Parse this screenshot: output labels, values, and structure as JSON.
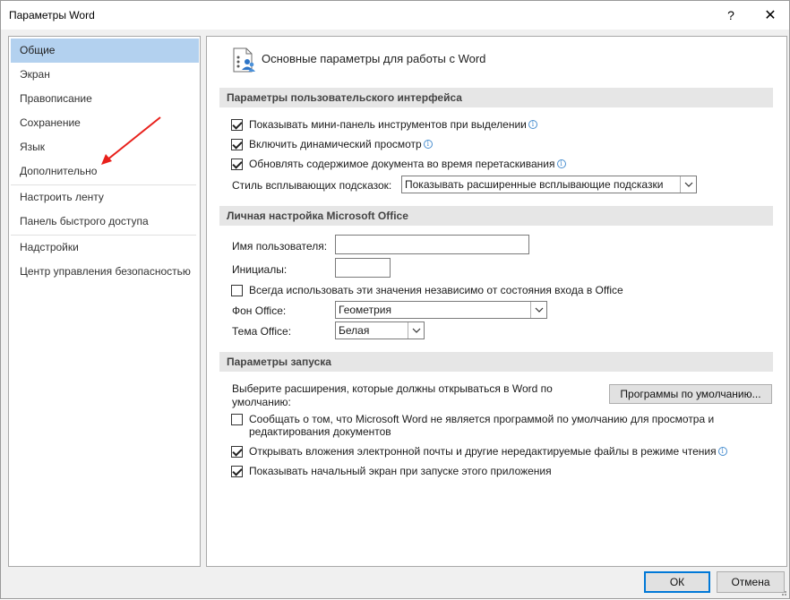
{
  "window": {
    "title": "Параметры Word",
    "help_label": "?",
    "close_label": "✕"
  },
  "nav": {
    "items": [
      {
        "label": "Общие",
        "selected": true
      },
      {
        "label": "Экран"
      },
      {
        "label": "Правописание"
      },
      {
        "label": "Сохранение"
      },
      {
        "label": "Язык"
      },
      {
        "label": "Дополнительно"
      },
      {
        "label": "Настроить ленту"
      },
      {
        "label": "Панель быстрого доступа"
      },
      {
        "label": "Надстройки"
      },
      {
        "label": "Центр управления безопасностью"
      }
    ]
  },
  "annotation": {
    "arrow_color": "#e8201b"
  },
  "content": {
    "header_title": "Основные параметры для работы с Word",
    "ui_section": {
      "title": "Параметры пользовательского интерфейса",
      "options": [
        {
          "label": "Показывать мини-панель инструментов при выделении",
          "checked": true
        },
        {
          "label": "Включить динамический просмотр",
          "checked": true
        },
        {
          "label": "Обновлять содержимое документа во время перетаскивания",
          "checked": true
        }
      ],
      "tooltip_style_label": "Стиль всплывающих подсказок:",
      "tooltip_style_value": "Показывать расширенные всплывающие подсказки"
    },
    "personal_section": {
      "title": "Личная настройка Microsoft Office",
      "username_label": "Имя пользователя:",
      "username_value": "",
      "initials_label": "Инициалы:",
      "initials_value": "",
      "always_use_label": "Всегда использовать эти значения независимо от состояния входа в Office",
      "always_use_checked": false,
      "background_label": "Фон Office:",
      "background_value": "Геометрия",
      "theme_label": "Тема Office:",
      "theme_value": "Белая"
    },
    "startup_section": {
      "title": "Параметры запуска",
      "extensions_text_line1": "Выберите расширения, которые должны открываться в Word по",
      "extensions_text_line2": "умолчанию:",
      "default_programs_button": "Программы по умолчанию...",
      "options": [
        {
          "label_line1": "Сообщать о том, что Microsoft Word не является программой по умолчанию для просмотра и",
          "label_line2": "редактирования документов",
          "checked": false
        },
        {
          "label_line1": "Открывать вложения электронной почты и другие нередактируемые файлы в режиме чтения",
          "checked": true
        },
        {
          "label_line1": "Показывать начальный экран при запуске этого приложения",
          "checked": true
        }
      ]
    }
  },
  "footer": {
    "ok_label": "ОК",
    "cancel_label": "Отмена"
  },
  "icons": {
    "info": "info-icon",
    "dropdown": "chevron-down-icon",
    "header": "general-settings-icon"
  }
}
